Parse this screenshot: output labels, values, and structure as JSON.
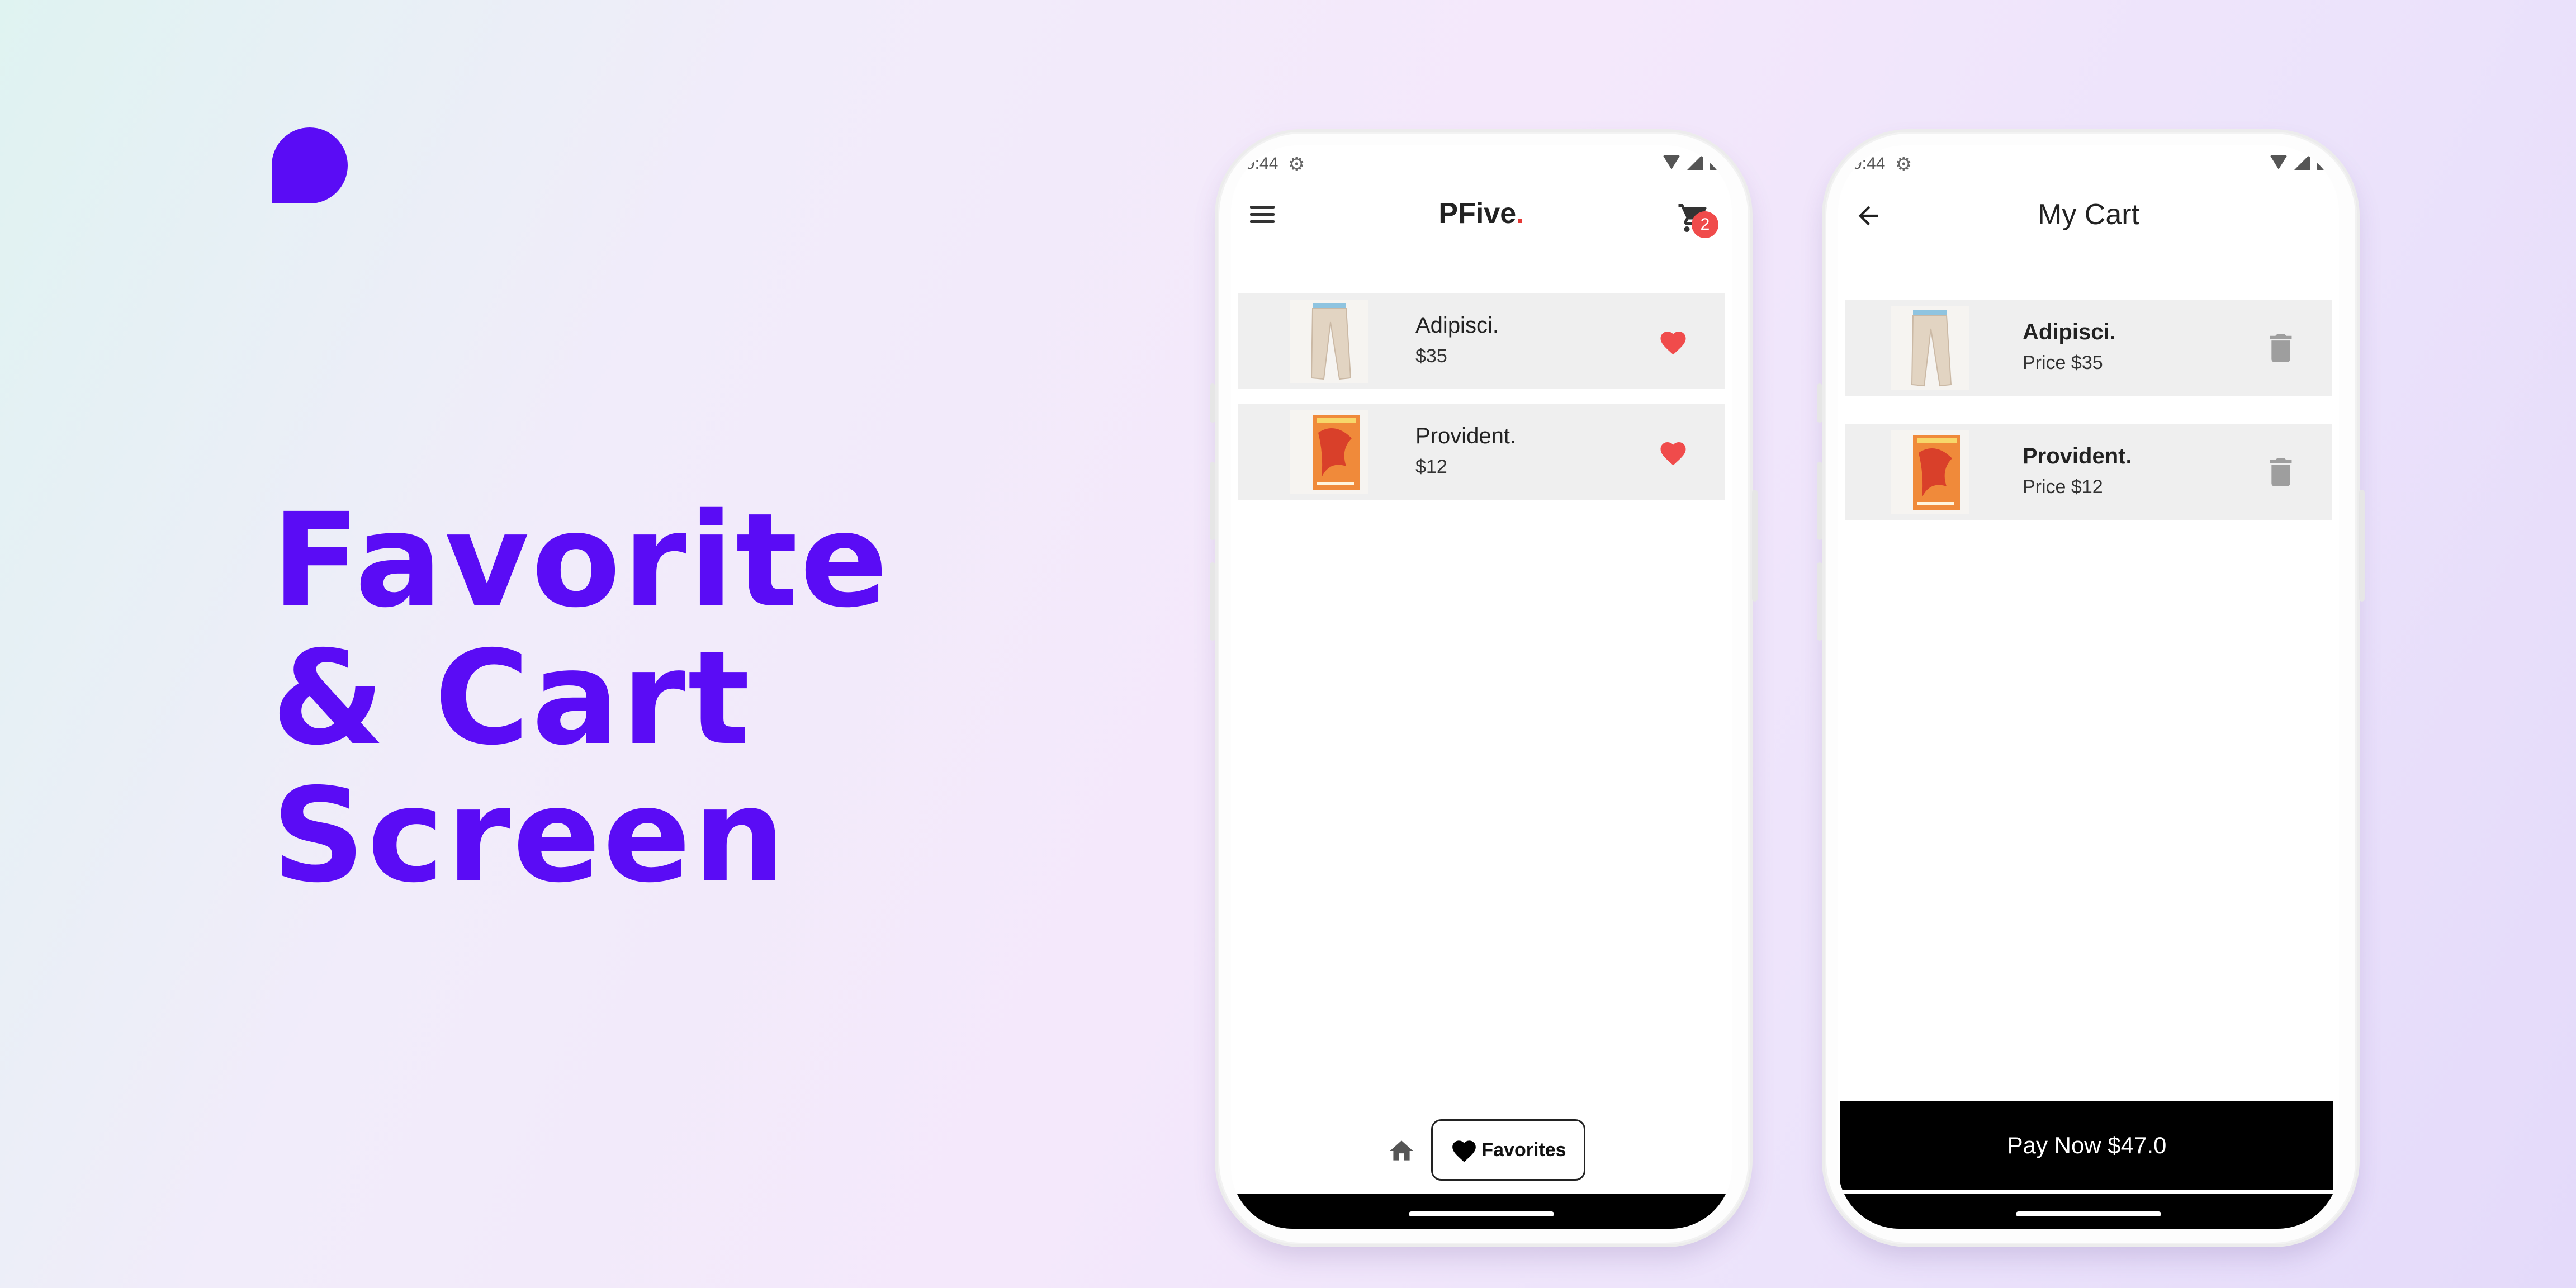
{
  "hero": {
    "headline": [
      "Favorite",
      "& Cart",
      "Screen"
    ],
    "brand_color": "#5a0cf5",
    "logo_icon": "speech-bubble-logo"
  },
  "status_bar": {
    "time": "9:44",
    "icons": [
      "settings-icon",
      "wifi-icon",
      "signal-icon",
      "battery-icon"
    ]
  },
  "favorites_screen": {
    "brand_name": "PFive",
    "brand_dot": ".",
    "menu_icon": "hamburger-menu-icon",
    "cart_icon": "shopping-cart-icon",
    "cart_badge": "2",
    "items": [
      {
        "name": "Adipisci.",
        "price": "$35",
        "thumbnail": "trousers-thumbnail",
        "favorite_icon": "heart-icon"
      },
      {
        "name": "Provident.",
        "price": "$12",
        "thumbnail": "book-cover-thumbnail",
        "favorite_icon": "heart-icon"
      }
    ],
    "bottom_nav": {
      "home_icon": "home-icon",
      "active_tab_label": "Favorites",
      "active_tab_icon": "heart-icon"
    }
  },
  "cart_screen": {
    "title": "My Cart",
    "back_icon": "arrow-left-icon",
    "items": [
      {
        "name": "Adipisci.",
        "price": "Price $35",
        "thumbnail": "trousers-thumbnail",
        "delete_icon": "trash-icon"
      },
      {
        "name": "Provident.",
        "price": "Price $12",
        "thumbnail": "book-cover-thumbnail",
        "delete_icon": "trash-icon"
      }
    ],
    "pay_button_label": "Pay Now $47.0"
  },
  "colors": {
    "heart": "#f04b4b",
    "badge": "#f04b4b",
    "item_background": "#efefef",
    "pay_button": "#000000"
  }
}
